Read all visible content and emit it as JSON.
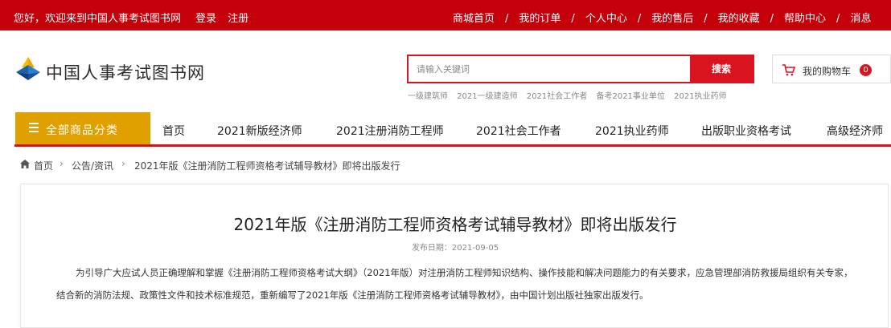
{
  "topbar": {
    "welcome": "您好，欢迎来到中国人事考试图书网",
    "login": "登录",
    "register": "注册",
    "links": [
      "商城首页",
      "我的订单",
      "个人中心",
      "我的售后",
      "我的收藏",
      "帮助中心",
      "消息"
    ],
    "separator": "/"
  },
  "header": {
    "logo_text": "中国人事考试图书网",
    "search_placeholder": "请输入关键词",
    "search_button": "搜索",
    "hot_words": [
      "一级建筑师",
      "2021一级建造师",
      "2021社会工作者",
      "备考2021事业单位",
      "2021执业药师"
    ],
    "cart_label": "我的购物车",
    "cart_count": "0"
  },
  "nav": {
    "category_label": "全部商品分类",
    "items": [
      "首页",
      "2021新版经济师",
      "2021注册消防工程师",
      "2021社会工作者",
      "2021执业药师",
      "出版职业资格考试",
      "高级经济师"
    ]
  },
  "breadcrumb": {
    "items": [
      "首页",
      "公告/资讯",
      "2021年版《注册消防工程师资格考试辅导教材》即将出版发行"
    ],
    "separator": "›"
  },
  "article": {
    "title": "2021年版《注册消防工程师资格考试辅导教材》即将出版发行",
    "date": "发布日期：2021-09-05",
    "paragraph": "为引导广大应试人员正确理解和掌握《注册消防工程师资格考试大纲》（2021年版）对注册消防工程师知识结构、操作技能和解决问题能力的有关要求，应急管理部消防救援局组织有关专家，结合新的消防法规、政策性文件和技术标准规范，重新编写了2021年版《注册消防工程师资格考试辅导教材》，由中国计划出版社独家出版发行。"
  },
  "colors": {
    "brand_red": "#c4000b",
    "accent_red": "#d9141e",
    "category_gold": "#e0a000"
  },
  "icons": {
    "logo": "logo-mark-icon",
    "cart": "cart-icon",
    "home": "home-icon",
    "menu": "menu-icon"
  }
}
